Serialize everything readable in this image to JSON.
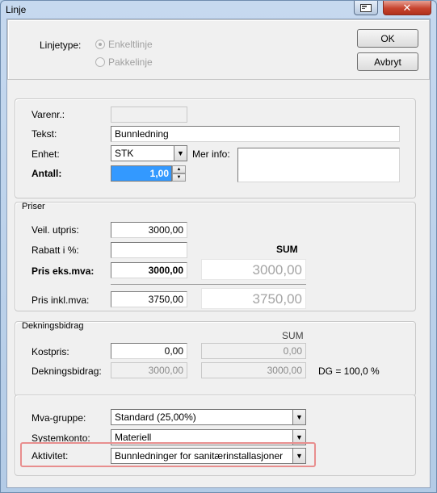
{
  "window": {
    "title": "Linje",
    "close_label": "✕"
  },
  "top": {
    "linjetype_label": "Linjetype:",
    "radio_enkeltlinje": "Enkeltlinje",
    "radio_pakkelinje": "Pakkelinje",
    "ok_label": "OK",
    "avbryt_label": "Avbryt"
  },
  "item": {
    "varenr_label": "Varenr.:",
    "varenr_value": "",
    "tekst_label": "Tekst:",
    "tekst_value": "Bunnledning",
    "enhet_label": "Enhet:",
    "enhet_value": "STK",
    "merinfo_label": "Mer info:",
    "antall_label": "Antall:",
    "antall_value": "1,00"
  },
  "priser": {
    "group_label": "Priser",
    "veil_label": "Veil. utpris:",
    "veil_value": "3000,00",
    "rabatt_label": "Rabatt i %:",
    "rabatt_value": "",
    "sum_header": "SUM",
    "pris_eks_label": "Pris eks.mva:",
    "pris_eks_value": "3000,00",
    "pris_eks_sum": "3000,00",
    "pris_inkl_label": "Pris inkl.mva:",
    "pris_inkl_value": "3750,00",
    "pris_inkl_sum": "3750,00"
  },
  "dekning": {
    "group_label": "Dekningsbidrag",
    "sum_header": "SUM",
    "kostpris_label": "Kostpris:",
    "kostpris_value": "0,00",
    "kostpris_sum": "0,00",
    "db_label": "Dekningsbidrag:",
    "db_value": "3000,00",
    "db_sum": "3000,00",
    "dg_text": "DG = 100,0 %"
  },
  "konto": {
    "mva_label": "Mva-gruppe:",
    "mva_value": "Standard (25,00%)",
    "system_label": "Systemkonto:",
    "system_value": "Materiell",
    "aktivitet_label": "Aktivitet:",
    "aktivitet_value": "Bunnledninger for sanitærinstallasjoner"
  },
  "colors": {
    "selection": "#3399ff",
    "highlight_border": "#e88e8e",
    "close_button": "#c7442f"
  }
}
